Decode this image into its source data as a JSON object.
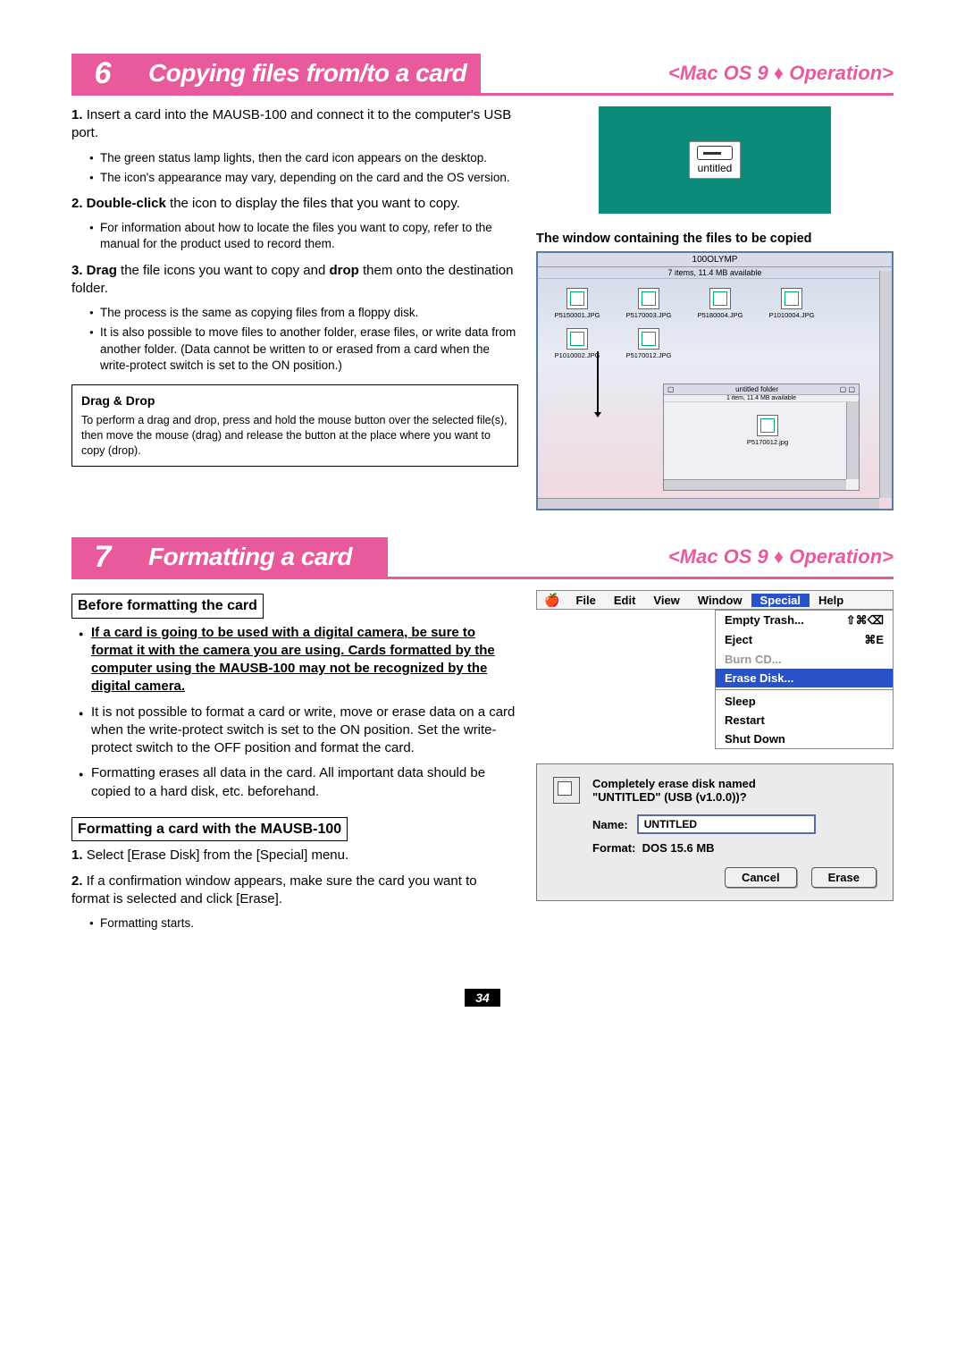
{
  "section6": {
    "num": "6",
    "title": "Copying files from/to a card",
    "sub": "<Mac OS 9 ♦ Operation>",
    "steps": {
      "s1": {
        "num": "1.",
        "text": "Insert a card into the MAUSB-100 and connect it to the computer's USB port."
      },
      "s1_b1": "The green status lamp lights, then the card icon appears on the desktop.",
      "s1_b2": "The icon's appearance may vary, depending on the card and the OS version.",
      "s2": {
        "numbold": "2. Double-click",
        "text": " the icon to display the files that you want to copy."
      },
      "s2_b1": "For information about how to locate the files you want to copy, refer to the manual for the product used to record them.",
      "s3": {
        "numbold": "3. Drag",
        "mid": " the file icons you want to copy and ",
        "bold2": "drop",
        "end": " them onto the destination folder."
      },
      "s3_b1": "The process is the same as copying files from a floppy disk.",
      "s3_b2": "It is also possible to move files to another folder, erase files, or write data from another folder. (Data cannot be written to or erased from a card when the write-protect switch is set to the ON position.)"
    },
    "dragdrop": {
      "title": "Drag & Drop",
      "body": "To perform a drag and drop, press and hold the mouse button over the selected file(s), then move the mouse (drag) and release the button at the place where you want to copy (drop)."
    },
    "desktop_icon_label": "untitled",
    "caption": "The window containing the files to be copied",
    "finder": {
      "title": "100OLYMP",
      "info": "7 items, 11.4 MB available",
      "files": [
        "P5150001.JPG",
        "P5170003.JPG",
        "P5180004.JPG",
        "P1010004.JPG",
        "P1010002.JPG",
        "P5170012.JPG"
      ],
      "subwin_title": "untitled folder",
      "subwin_info": "1 item, 11.4 MB available",
      "subwin_file": "P5170012.jpg"
    }
  },
  "section7": {
    "num": "7",
    "title": "Formatting a card",
    "sub": "<Mac OS 9 ♦ Operation>",
    "before_heading": "Before formatting the card",
    "bullets": {
      "b1": "If a card is going to be used with a digital camera, be sure to format it with the camera you are using. Cards formatted by the computer using the MAUSB-100 may not be recognized by the digital camera.",
      "b2": "It is not possible to format a card or write, move or erase data on a card when the write-protect switch is set to the ON position. Set the write-protect switch to the OFF position and format the card.",
      "b3": "Formatting erases all data in the card. All important data should be copied to a hard disk, etc. beforehand."
    },
    "withmausb_heading": "Formatting a card with the MAUSB-100",
    "steps": {
      "s1": {
        "num": "1.",
        "text": "Select [Erase Disk] from the [Special] menu."
      },
      "s2": {
        "num": "2.",
        "text": "If a confirmation window appears, make sure the card you want to format is selected and click [Erase]."
      },
      "s2_b1": "Formatting starts."
    },
    "menubar": {
      "items": [
        "File",
        "Edit",
        "View",
        "Window",
        "Special",
        "Help"
      ]
    },
    "dropdown": {
      "empty": "Empty Trash...",
      "empty_sc": "⇧⌘⌫",
      "eject": "Eject",
      "eject_sc": "⌘E",
      "burn": "Burn CD...",
      "erase": "Erase Disk...",
      "sleep": "Sleep",
      "restart": "Restart",
      "shutdown": "Shut Down"
    },
    "dialog": {
      "line1": "Completely erase disk named",
      "line2": "\"UNTITLED\" (USB (v1.0.0))?",
      "name_label": "Name:",
      "name_value": "UNTITLED",
      "format_label": "Format:",
      "format_value": "DOS 15.6 MB",
      "cancel": "Cancel",
      "erase": "Erase"
    }
  },
  "page_number": "34"
}
